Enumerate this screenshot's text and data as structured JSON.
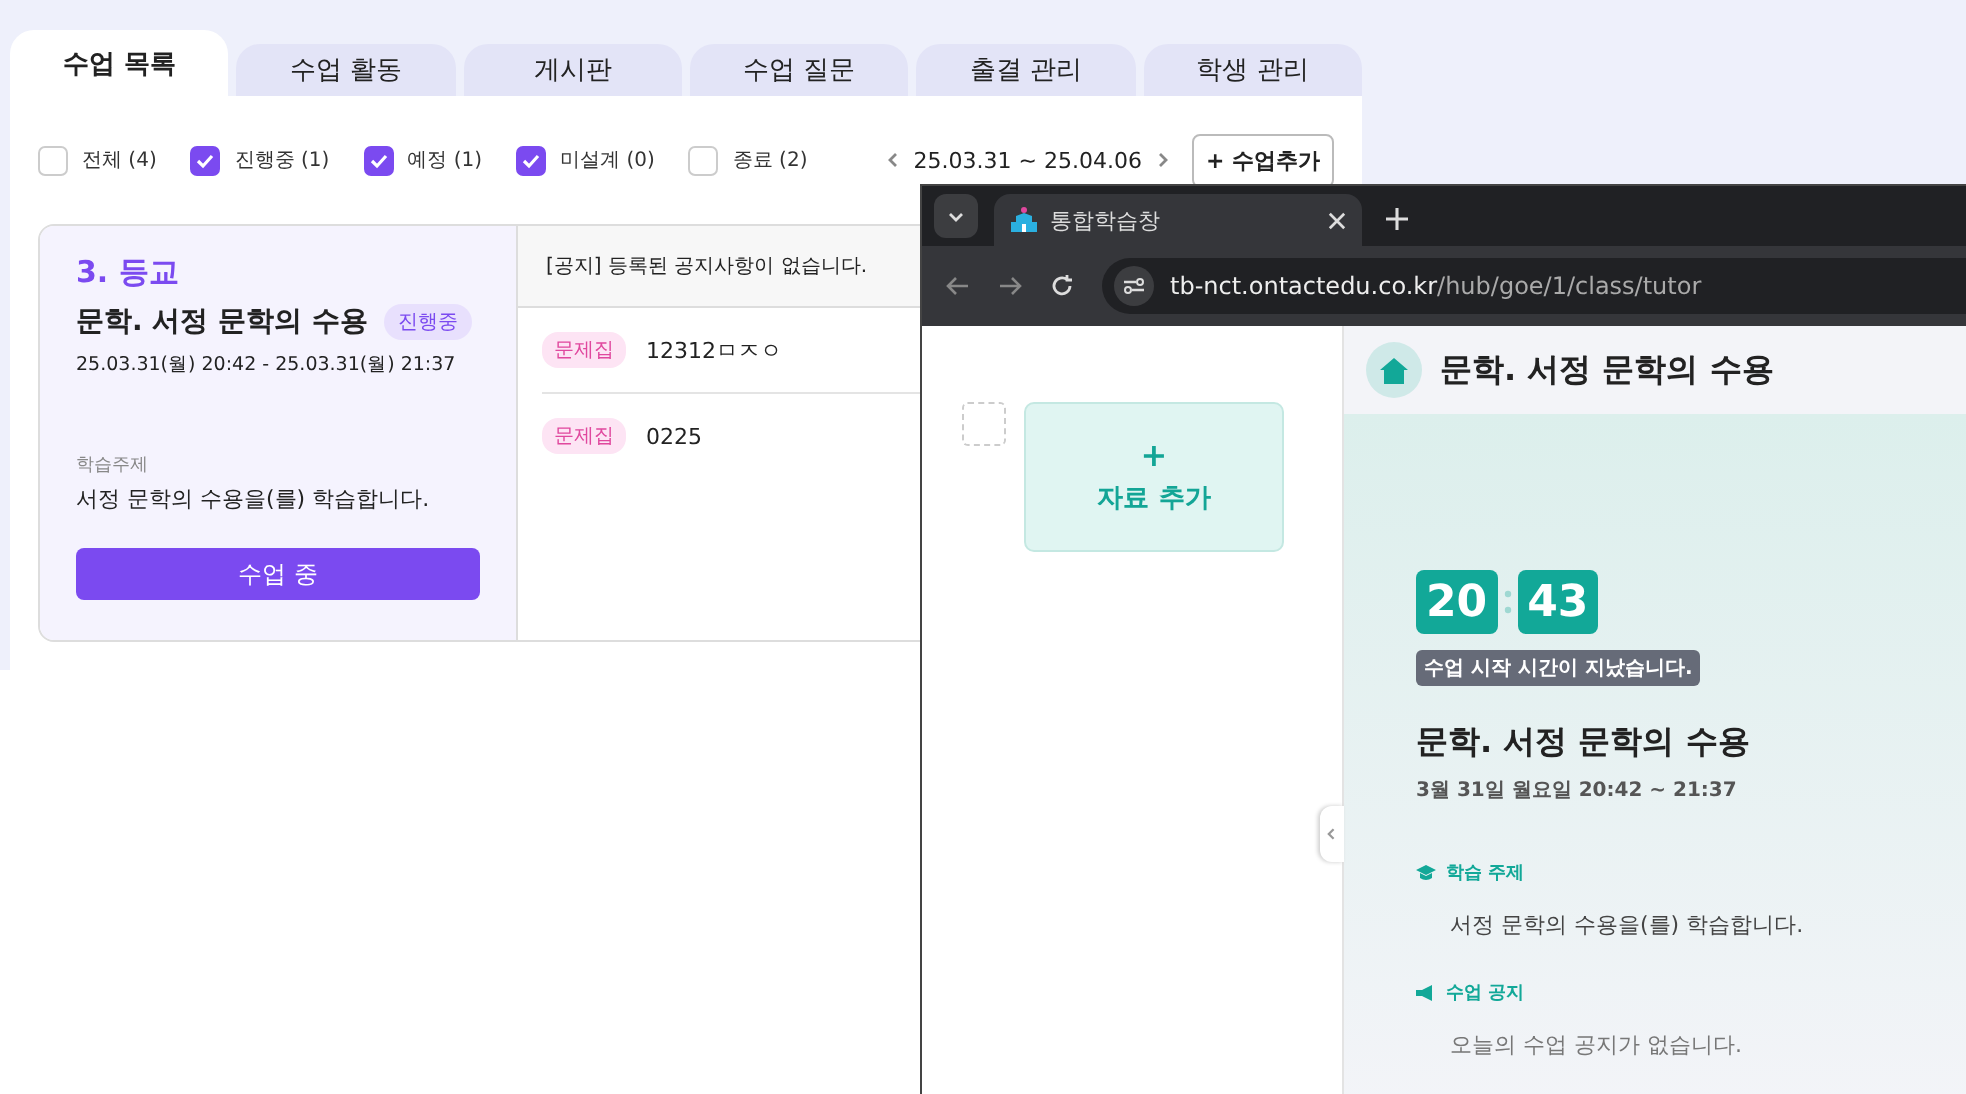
{
  "tabs": [
    {
      "label": "수업 목록",
      "selected": true
    },
    {
      "label": "수업 활동",
      "selected": false
    },
    {
      "label": "게시판",
      "selected": false
    },
    {
      "label": "수업 질문",
      "selected": false
    },
    {
      "label": "출결 관리",
      "selected": false
    },
    {
      "label": "학생 관리",
      "selected": false
    }
  ],
  "filters": [
    {
      "label": "전체 (4)",
      "checked": false
    },
    {
      "label": "진행중 (1)",
      "checked": true
    },
    {
      "label": "예정 (1)",
      "checked": true
    },
    {
      "label": "미설계 (0)",
      "checked": true
    },
    {
      "label": "종료 (2)",
      "checked": false
    }
  ],
  "date_range": "25.03.31 ~ 25.04.06",
  "add_button": "+ 수업추가",
  "lesson": {
    "period": "3. 등교",
    "title": "문학. 서정 문학의 수용",
    "status": "진행중",
    "time": "25.03.31(월) 20:42 - 25.03.31(월) 21:37",
    "topic_label": "학습주제",
    "topic": "서정 문학의 수용을(를) 학습합니다.",
    "button": "수업 중"
  },
  "notice": "[공지] 등록된 공지사항이 없습니다.",
  "materials": [
    {
      "tag": "문제집",
      "name": "12312ㅁㅈㅇ"
    },
    {
      "tag": "문제집",
      "name": "0225"
    }
  ],
  "browser": {
    "tab_title": "통합학습창",
    "url_host": "tb-nct.ontactedu.co.kr",
    "url_path": "/hub/goe/1/class/tutor",
    "select_checked": false,
    "add_material": {
      "plus": "+",
      "label": "자료 추가"
    },
    "header_title": "문학. 서정 문학의 수용",
    "clock": {
      "hour": "20",
      "minute": "43"
    },
    "status_tip": "수업 시작 시간이 지났습니다.",
    "class_title": "문학. 서정 문학의 수용",
    "class_time": "3월 31일 월요일 20:42 ~ 21:37",
    "sections": [
      {
        "kind": "topic",
        "label": "학습 주제",
        "text": "서정 문학의 수용을(를) 학습합니다."
      },
      {
        "kind": "notice",
        "label": "수업 공지",
        "text": "오늘의 수업 공지가 없습니다."
      }
    ]
  }
}
